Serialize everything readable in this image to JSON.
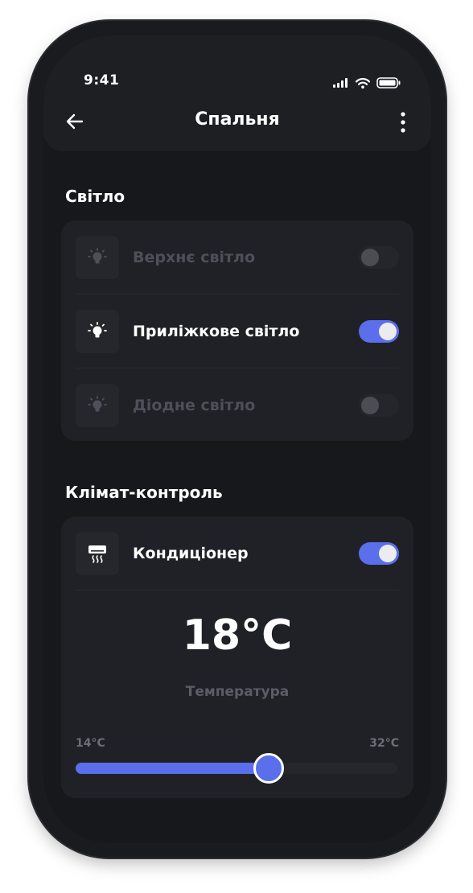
{
  "status_bar": {
    "time": "9:41"
  },
  "header": {
    "title": "Спальня"
  },
  "lights": {
    "section_title": "Світло",
    "items": [
      {
        "label": "Верхнє світло",
        "on": false,
        "icon": "bulb-icon"
      },
      {
        "label": "Приліжкове світло",
        "on": true,
        "icon": "bulb-icon"
      },
      {
        "label": "Діодне світло",
        "on": false,
        "icon": "bulb-icon"
      }
    ]
  },
  "climate": {
    "section_title": "Клімат-контроль",
    "ac": {
      "label": "Кондиціонер",
      "on": true,
      "icon": "air-conditioner-icon"
    },
    "temperature": {
      "value": "18°C",
      "label": "Температура",
      "min_label": "14°C",
      "max_label": "32°C",
      "level": 0.6
    }
  },
  "colors": {
    "accent": "#5b6eeb",
    "background": "#17181b",
    "card": "#202126",
    "muted_text": "#4d5059"
  }
}
